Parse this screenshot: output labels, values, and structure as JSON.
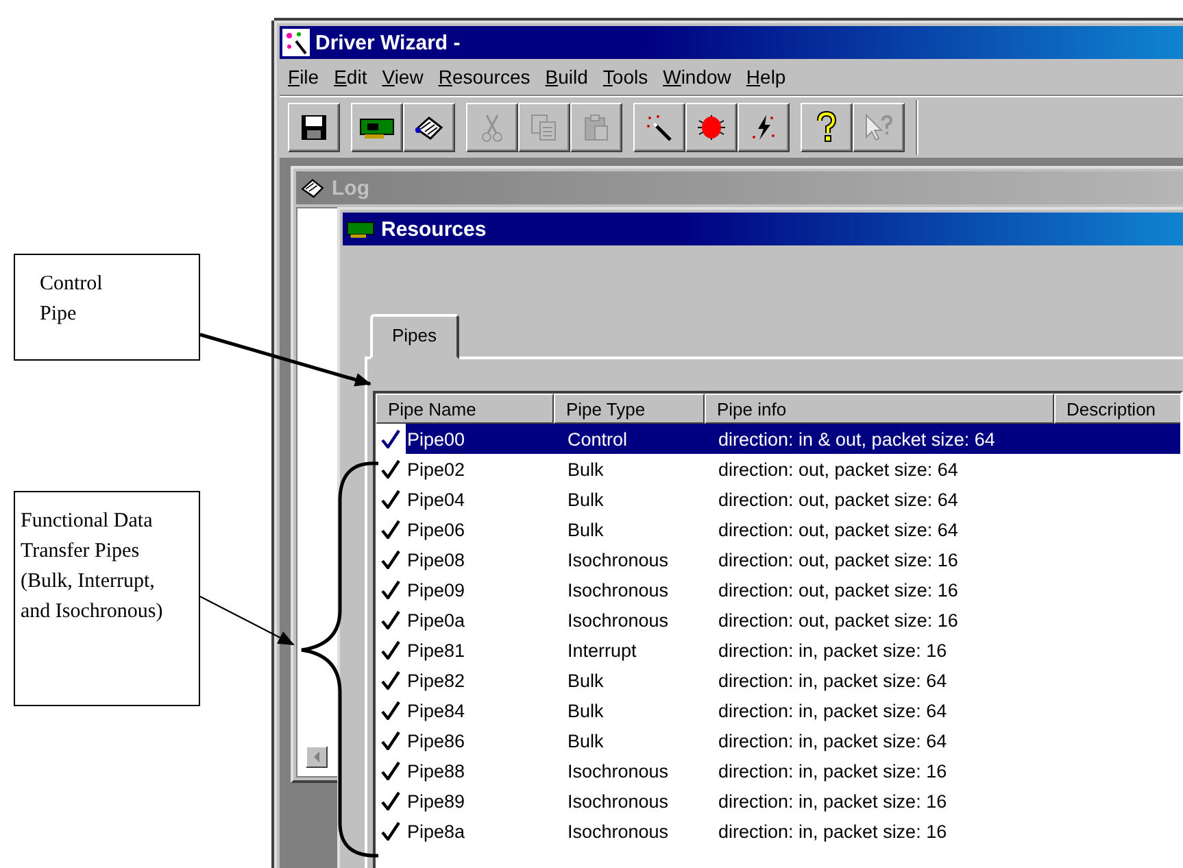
{
  "callouts": [
    {
      "text": "Control Pipe",
      "kind": "control"
    },
    {
      "text": "Functional Data Transfer Pipes (Bulk, Interrupt, and Isochronous)",
      "kind": "functional"
    }
  ],
  "window": {
    "title": "Driver Wizard -"
  },
  "menu": [
    "File",
    "Edit",
    "View",
    "Resources",
    "Build",
    "Tools",
    "Window",
    "Help"
  ],
  "toolbar": [
    [
      {
        "kind": "save",
        "disabled": false
      }
    ],
    [
      {
        "kind": "card",
        "disabled": false
      },
      {
        "kind": "probe",
        "disabled": false
      }
    ],
    [
      {
        "kind": "cut",
        "disabled": true
      },
      {
        "kind": "copy",
        "disabled": true
      },
      {
        "kind": "paste",
        "disabled": true
      }
    ],
    [
      {
        "kind": "wand",
        "disabled": false
      },
      {
        "kind": "bug",
        "disabled": false
      },
      {
        "kind": "bolt",
        "disabled": false
      }
    ],
    [
      {
        "kind": "help",
        "disabled": false
      },
      {
        "kind": "context-help",
        "disabled": true
      }
    ]
  ],
  "log_window": {
    "title": "Log",
    "active": false
  },
  "resources_window": {
    "title": "Resources",
    "active": true,
    "tabs": [
      {
        "label": "Pipes",
        "selected": true
      }
    ],
    "columns": [
      "Pipe Name",
      "Pipe Type",
      "Pipe info",
      "Description"
    ],
    "rows": [
      {
        "name": "Pipe00",
        "type": "Control",
        "info": "direction: in & out, packet size: 64",
        "checked": true,
        "selected": true
      },
      {
        "name": "Pipe02",
        "type": "Bulk",
        "info": "direction: out, packet size: 64",
        "checked": true,
        "selected": false
      },
      {
        "name": "Pipe04",
        "type": "Bulk",
        "info": "direction: out, packet size: 64",
        "checked": true,
        "selected": false
      },
      {
        "name": "Pipe06",
        "type": "Bulk",
        "info": "direction: out, packet size: 64",
        "checked": true,
        "selected": false
      },
      {
        "name": "Pipe08",
        "type": "Isochronous",
        "info": "direction: out, packet size: 16",
        "checked": true,
        "selected": false
      },
      {
        "name": "Pipe09",
        "type": "Isochronous",
        "info": "direction: out, packet size: 16",
        "checked": true,
        "selected": false
      },
      {
        "name": "Pipe0a",
        "type": "Isochronous",
        "info": "direction: out, packet size: 16",
        "checked": true,
        "selected": false
      },
      {
        "name": "Pipe81",
        "type": "Interrupt",
        "info": "direction: in, packet size: 16",
        "checked": true,
        "selected": false
      },
      {
        "name": "Pipe82",
        "type": "Bulk",
        "info": "direction: in, packet size: 64",
        "checked": true,
        "selected": false
      },
      {
        "name": "Pipe84",
        "type": "Bulk",
        "info": "direction: in, packet size: 64",
        "checked": true,
        "selected": false
      },
      {
        "name": "Pipe86",
        "type": "Bulk",
        "info": "direction: in, packet size: 64",
        "checked": true,
        "selected": false
      },
      {
        "name": "Pipe88",
        "type": "Isochronous",
        "info": "direction: in, packet size: 16",
        "checked": true,
        "selected": false
      },
      {
        "name": "Pipe89",
        "type": "Isochronous",
        "info": "direction: in, packet size: 16",
        "checked": true,
        "selected": false
      },
      {
        "name": "Pipe8a",
        "type": "Isochronous",
        "info": "direction: in, packet size: 16",
        "checked": true,
        "selected": false
      }
    ]
  }
}
